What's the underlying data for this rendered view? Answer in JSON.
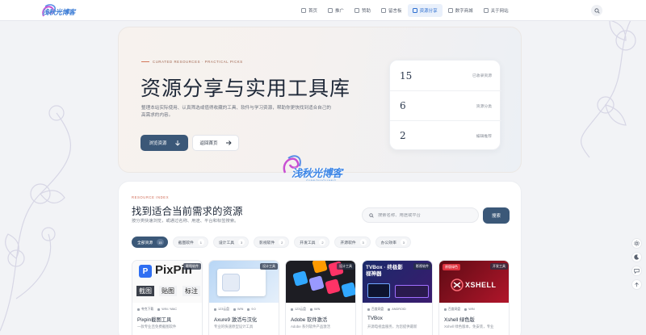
{
  "header": {
    "logo_text": "浅秋光博客",
    "nav": [
      {
        "label": "首页",
        "icon": "home-icon",
        "active": false
      },
      {
        "label": "推广",
        "icon": "megaphone-icon",
        "active": false
      },
      {
        "label": "赞助",
        "icon": "gift-icon",
        "active": false
      },
      {
        "label": "留言板",
        "icon": "chat-icon",
        "active": false
      },
      {
        "label": "资源分享",
        "icon": "folder-icon",
        "active": true
      },
      {
        "label": "数字商城",
        "icon": "cart-icon",
        "active": false
      },
      {
        "label": "关于网站",
        "icon": "info-icon",
        "active": false
      }
    ]
  },
  "hero": {
    "eyebrow": "CURATED RESOURCES · PRACTICAL PICKS",
    "title": "资源分享与实用工具库",
    "description": "整理本站实际使用、认真筛选或值得收藏的工具、软件与学习资源，帮助你更快找到适合自己的高需求的内容。",
    "primary_button": "浏览资源",
    "secondary_button": "返回首页",
    "stats": [
      {
        "value": "15",
        "label": "已收录资源"
      },
      {
        "value": "6",
        "label": "资源分类"
      },
      {
        "value": "2",
        "label": "编辑推荐"
      }
    ]
  },
  "watermark": {
    "text": "浅秋光博客",
    "sub": "QIANQIUGUANG"
  },
  "resources": {
    "eyebrow": "RESOURCE INDEX",
    "title": "找到适合当前需求的资源",
    "subtitle": "按分类快速浏览，或通过名称、用途、平台和标签搜索。",
    "search_placeholder": "搜索名称、用途或平台",
    "search_button": "搜索",
    "filters": [
      {
        "label": "全部资源",
        "count": "15",
        "active": true
      },
      {
        "label": "截图软件",
        "count": "1",
        "active": false
      },
      {
        "label": "设计工具",
        "count": "3",
        "active": false
      },
      {
        "label": "影视软件",
        "count": "2",
        "active": false
      },
      {
        "label": "开发工具",
        "count": "2",
        "active": false
      },
      {
        "label": "开源软件",
        "count": "3",
        "active": false
      },
      {
        "label": "办公效率",
        "count": "3",
        "active": false
      }
    ],
    "cards": [
      {
        "title": "Pixpin截图工具",
        "desc": "一款专业且免费截图软件",
        "badge": "截图软件",
        "meta": [
          "夸克下载",
          "WIN / MAC"
        ],
        "thumb_text": "PixPin",
        "thumb_keys": [
          "截图",
          "贴图",
          "标注"
        ]
      },
      {
        "title": "Axure9 激活与汉化",
        "desc": "专业的快速原型设计工具",
        "badge": "设计工具",
        "meta": [
          "123云盘",
          "WIN",
          "9.0"
        ],
        "thumb_text": "",
        "thumb_keys": []
      },
      {
        "title": "Adobe 软件激活",
        "desc": "Adobe 系列软件产品激活",
        "badge": "设计工具",
        "meta": [
          "123云盘",
          "WIN"
        ],
        "thumb_text": "",
        "thumb_keys": []
      },
      {
        "title": "TVBox",
        "desc": "开源电视盒服务，为您提供最新",
        "badge": "影视软件",
        "meta": [
          "百度网盘",
          "ANDROID"
        ],
        "thumb_text": "TVBox · 终极影视神器",
        "thumb_keys": []
      },
      {
        "title": "Xshell 绿色版",
        "desc": "Xshell 绿色版本，免安装，专业",
        "badge": "开发工具",
        "meta": [
          "百度网盘",
          "WIN"
        ],
        "thumb_text": "XSHELL",
        "thumb_keys": [
          "原版绿色"
        ]
      }
    ]
  },
  "float_toolbar": [
    "settings-icon",
    "moon-icon",
    "comment-icon",
    "up-arrow-icon"
  ],
  "colors": {
    "accent": "#3b5878",
    "nav_active": "#2d6fd0",
    "eyebrow": "#d06a55"
  }
}
